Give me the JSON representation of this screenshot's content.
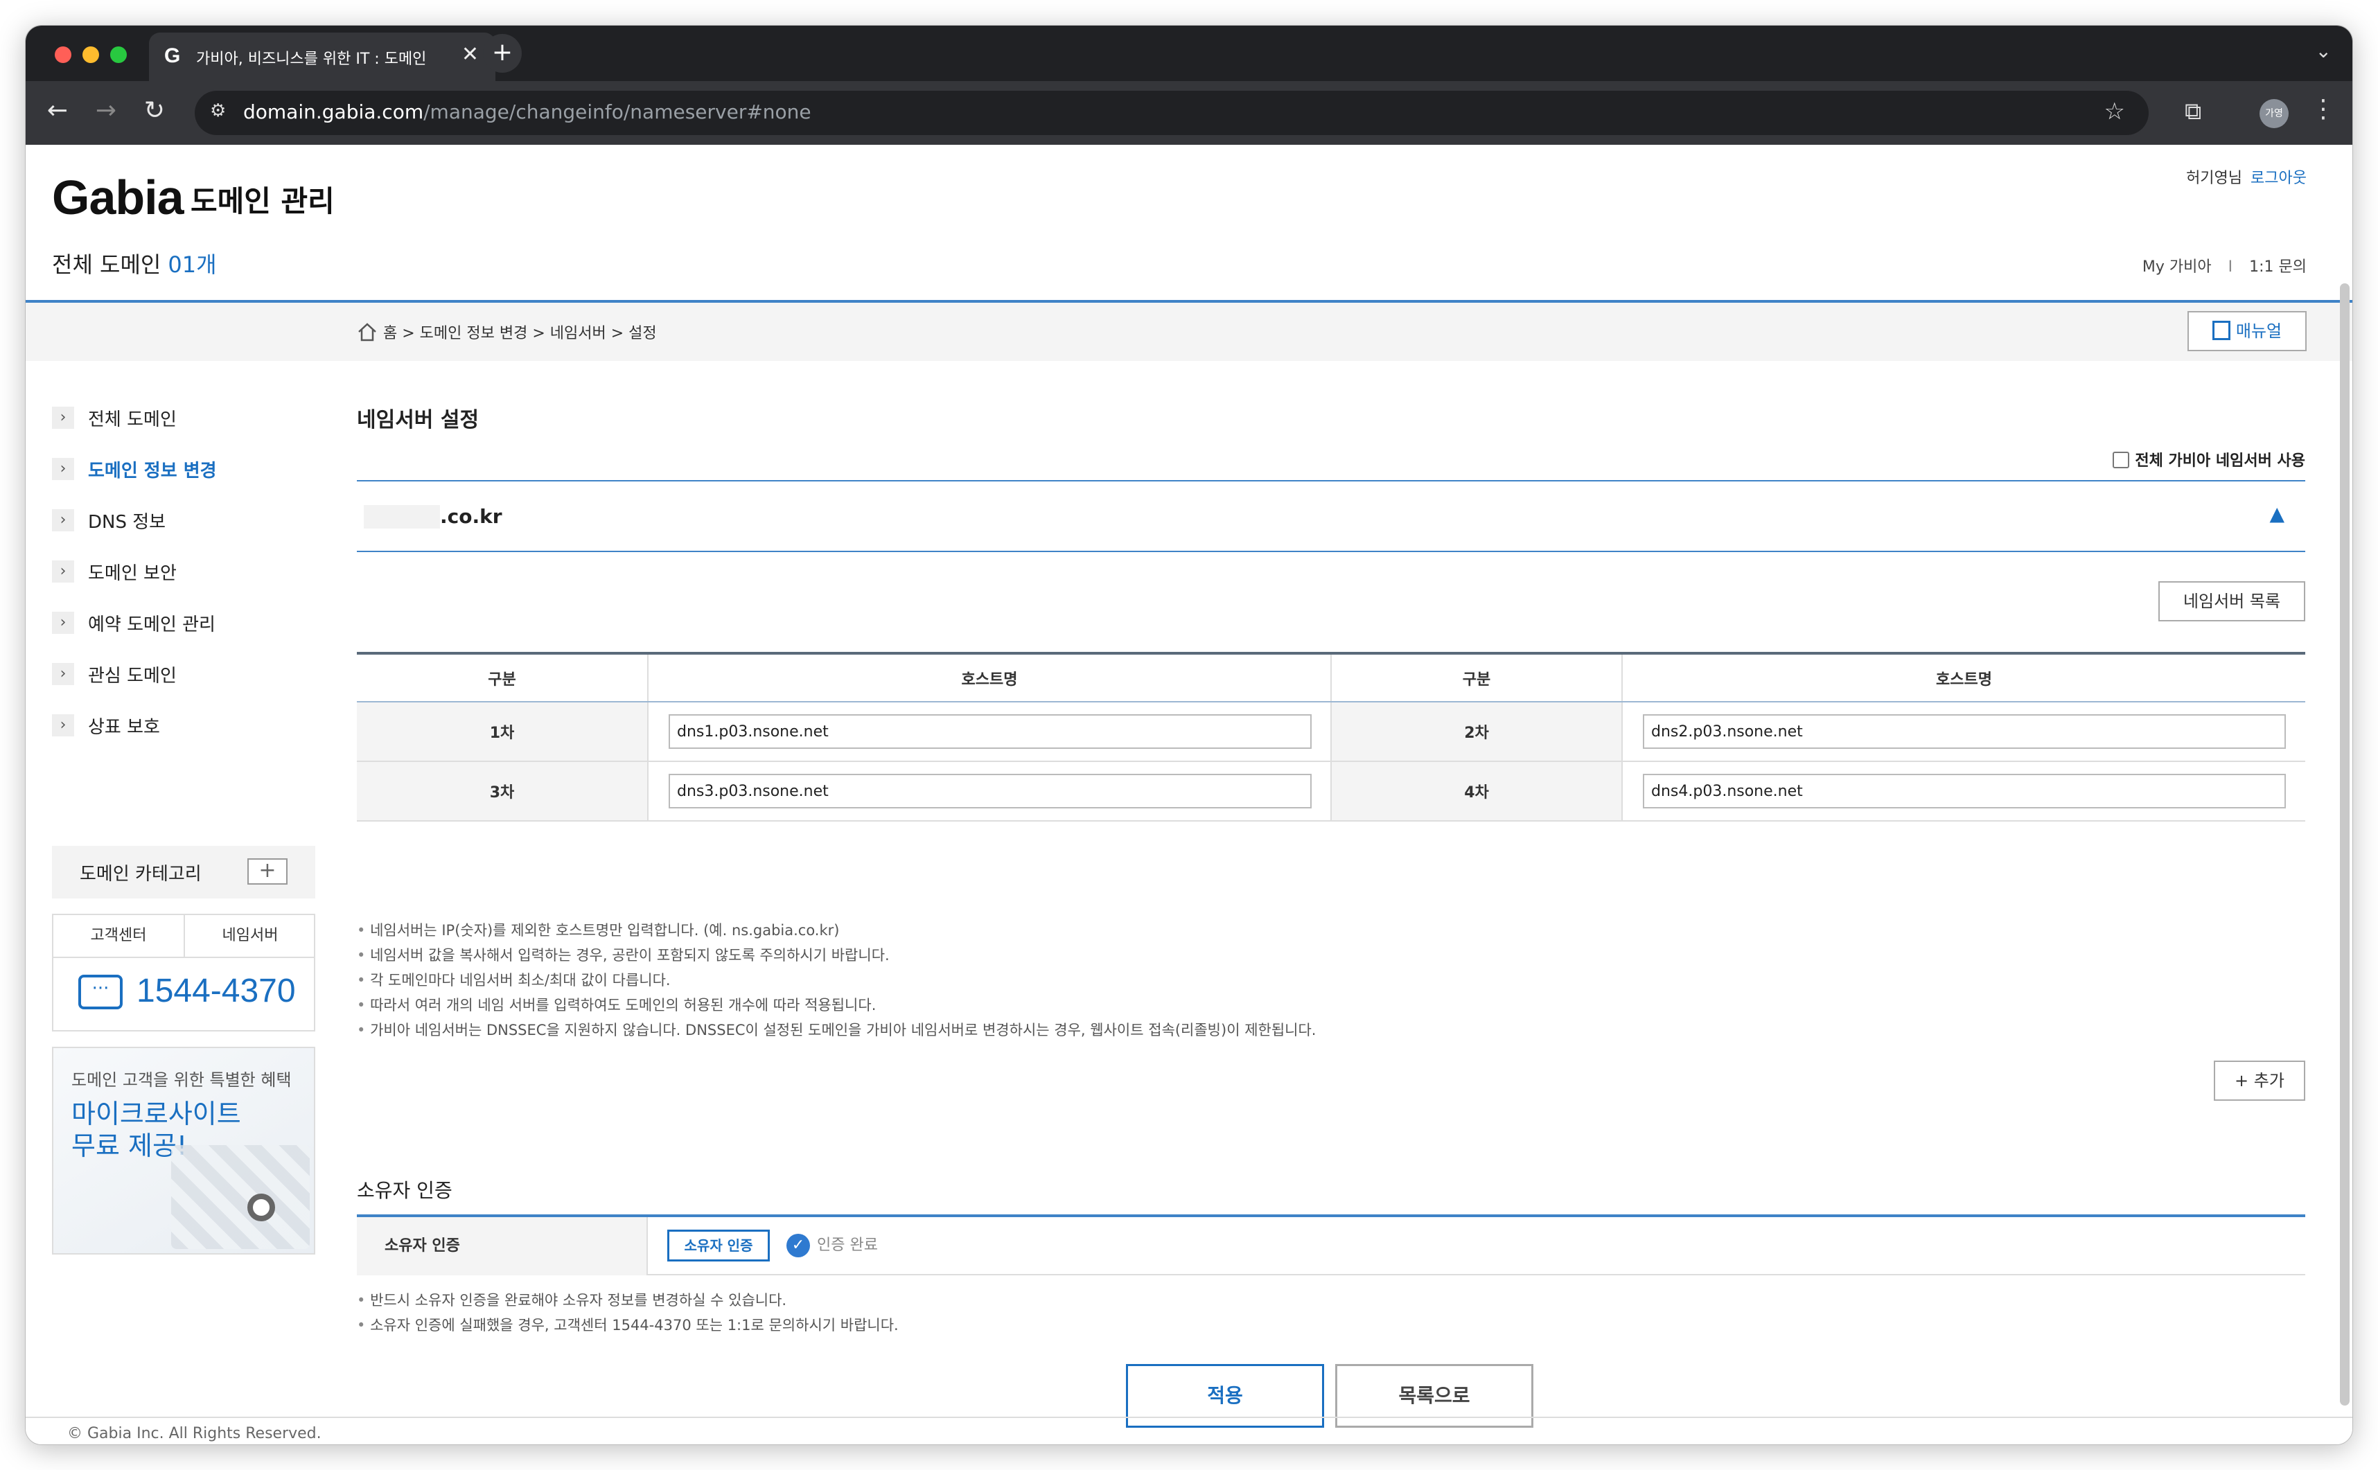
{
  "browser": {
    "tab_title": "가비아, 비즈니스를 위한 IT : 도메인",
    "tab_favicon": "G",
    "tab_close": "✕",
    "new_tab": "+",
    "url_host": "domain.gabia.com",
    "url_path": "/manage/changeinfo/nameserver#none",
    "profile": "가영"
  },
  "header": {
    "logo": "Gabia",
    "logo_sub": "도메인 관리",
    "user_name": "허기영님",
    "logout": "로그아웃",
    "all_domains_label": "전체 도메인",
    "all_domains_count": "01개",
    "my_gabia": "My 가비아",
    "separator": "I",
    "inquiry": "1:1 문의"
  },
  "breadcrumb": {
    "path": "홈 > 도메인 정보 변경 > 네임서버 > 설정",
    "manual_button": "매뉴얼"
  },
  "sidebar": {
    "items": [
      {
        "label": "전체 도메인"
      },
      {
        "label": "도메인 정보 변경"
      },
      {
        "label": "DNS 정보"
      },
      {
        "label": "도메인 보안"
      },
      {
        "label": "예약 도메인 관리"
      },
      {
        "label": "관심 도메인"
      },
      {
        "label": "상표 보호"
      }
    ],
    "category_label": "도메인 카테고리",
    "category_add": "+",
    "cs_tab1": "고객센터",
    "cs_tab2": "네임서버",
    "cs_phone": "1544-4370",
    "promo_line1": "도메인 고객을 위한 특별한 혜택",
    "promo_line2": "마이크로사이트",
    "promo_line3": "무료 제공!"
  },
  "main": {
    "title": "네임서버 설정",
    "use_all_gabia": "전체 가비아 네임서버 사용",
    "domain_suffix": ".co.kr",
    "collapse_icon": "▲",
    "ns_list_button": "네임서버 목록",
    "table": {
      "col_type": "구분",
      "col_host": "호스트명",
      "rows": [
        {
          "l1": "1차",
          "v1": "dns1.p03.nsone.net",
          "l2": "2차",
          "v2": "dns2.p03.nsone.net"
        },
        {
          "l1": "3차",
          "v1": "dns3.p03.nsone.net",
          "l2": "4차",
          "v2": "dns4.p03.nsone.net"
        }
      ]
    },
    "notes": [
      "네임서버는 IP(숫자)를 제외한 호스트명만 입력합니다. (예. ns.gabia.co.kr)",
      "네임서버 값을 복사해서 입력하는 경우, 공란이 포함되지 않도록 주의하시기 바랍니다.",
      "각 도메인마다 네임서버 최소/최대 값이 다릅니다.",
      "따라서 여러 개의 네임 서버를 입력하여도 도메인의 허용된 개수에 따라 적용됩니다.",
      "가비아 네임서버는 DNSSEC을 지원하지 않습니다. DNSSEC이 설정된 도메인을 가비아 네임서버로 변경하시는 경우, 웹사이트 접속(리졸빙)이 제한됩니다."
    ],
    "add_button": "+ 추가",
    "owner_title": "소유자 인증",
    "owner_label": "소유자 인증",
    "owner_button": "소유자 인증",
    "owner_status": "인증 완료",
    "owner_notes": [
      "반드시 소유자 인증을 완료해야 소유자 정보를 변경하실 수 있습니다.",
      "소유자 인증에 실패했을 경우, 고객센터 1544-4370 또는 1:1로 문의하시기 바랍니다."
    ],
    "apply_button": "적용",
    "list_button": "목록으로"
  },
  "footer": {
    "copyright": "© Gabia Inc. All Rights Reserved."
  },
  "colors": {
    "accent": "#1a6fc1",
    "rule": "#3f83c7"
  }
}
